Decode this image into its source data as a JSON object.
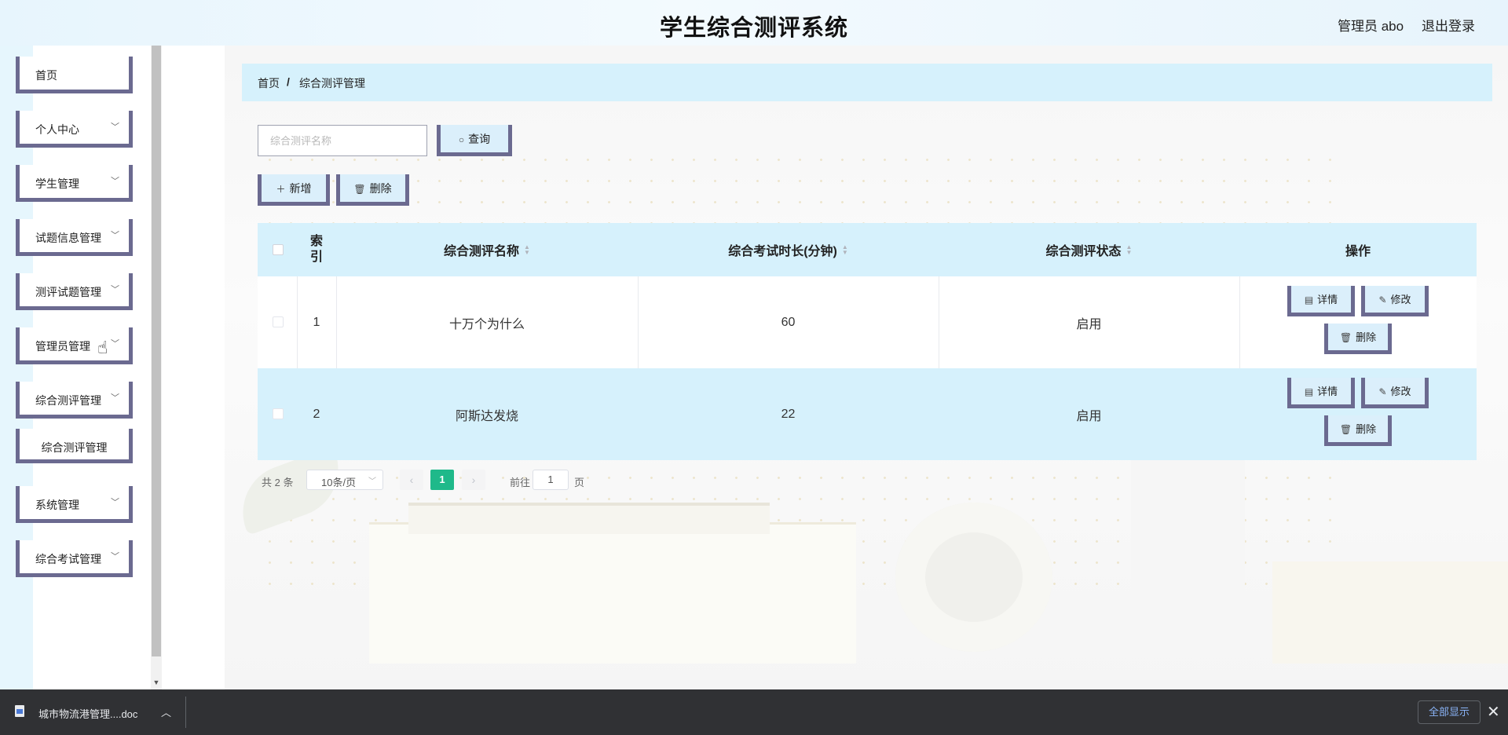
{
  "header": {
    "title": "学生综合测评系统",
    "user": "管理员 abo",
    "logout": "退出登录"
  },
  "sidebar": {
    "items": [
      {
        "label": "首页",
        "has_children": false
      },
      {
        "label": "个人中心",
        "has_children": true
      },
      {
        "label": "学生管理",
        "has_children": true
      },
      {
        "label": "试题信息管理",
        "has_children": true
      },
      {
        "label": "测评试题管理",
        "has_children": true
      },
      {
        "label": "管理员管理",
        "has_children": true
      },
      {
        "label": "综合测评管理",
        "has_children": true,
        "expanded": true
      },
      {
        "label": "综合测评管理",
        "submenu": true
      },
      {
        "label": "系统管理",
        "has_children": true
      },
      {
        "label": "综合考试管理",
        "has_children": true
      }
    ]
  },
  "breadcrumb": {
    "home": "首页",
    "separator": "/",
    "current": "综合测评管理"
  },
  "search": {
    "placeholder": "综合测评名称",
    "value": "",
    "button": "查询"
  },
  "toolbar": {
    "add": "新增",
    "delete": "删除"
  },
  "table": {
    "headers": {
      "index": "索引",
      "name": "综合测评名称",
      "duration": "综合考试时长(分钟)",
      "status": "综合测评状态",
      "actions": "操作"
    },
    "rows": [
      {
        "index": "1",
        "name": "十万个为什么",
        "duration": "60",
        "status": "启用"
      },
      {
        "index": "2",
        "name": "阿斯达发烧",
        "duration": "22",
        "status": "启用"
      }
    ],
    "row_actions": {
      "detail": "详情",
      "edit": "修改",
      "delete": "删除"
    }
  },
  "pagination": {
    "total": "共 2 条",
    "page_size": "10条/页",
    "current_page": "1",
    "goto_label": "前往",
    "goto_value": "1",
    "page_unit": "页"
  },
  "download_bar": {
    "file_name": "城市物流港管理....doc",
    "show_all": "全部显示"
  },
  "colors": {
    "accent": "#1fb98a",
    "header_bg": "#d6f1fc",
    "border_accent": "#6b6a90",
    "download_link": "#8ab4f8"
  }
}
